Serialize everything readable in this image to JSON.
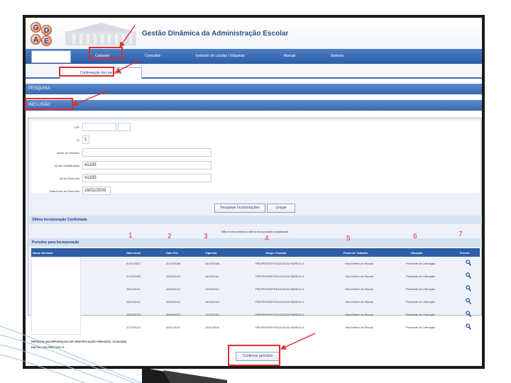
{
  "app": {
    "logo_letters": [
      "G",
      "D",
      "A",
      "E"
    ],
    "title": "Gestão Dinâmica da Administração Escolar"
  },
  "menu": {
    "items": [
      "Cadastro",
      "Consultas",
      "Emissão de Laudas / Etiquetas",
      "Manual",
      "Sistema"
    ]
  },
  "tab": {
    "label": "Confirmação dos períodos"
  },
  "sections": {
    "pesquisa": "PESQUISA",
    "inclusao": "INCLUSÃO"
  },
  "form": {
    "fields": [
      {
        "label": "CPF",
        "value": ""
      },
      {
        "label": "DI",
        "value": "1"
      },
      {
        "label": "Nome do Servidor",
        "value": ""
      },
      {
        "label": "UA de Classificação",
        "value": "41335"
      },
      {
        "label": "UA de Exercício",
        "value": "41335"
      },
      {
        "label": "Data Início de Exercício",
        "value": "16/02/2009"
      }
    ],
    "search_button": "Pesquisar Incorporações",
    "clear_button": "Limpar"
  },
  "ultima": {
    "title": "Última Incorporação Confirmada",
    "notice": "Não foi encontrada a última incorporação cadastrada"
  },
  "periodos": {
    "title": "Períodos para Incorporação",
    "columns": [
      "Nome Servidor",
      "Data Inicio",
      "Data Fim",
      "Vigência",
      "Cargo / Função",
      "Posto de Trabalho",
      "Situação",
      "Evento"
    ],
    "rows": [
      {
        "inicio": "01/11/2007",
        "fim": "31/10/2008",
        "vigencia": "31/10/2008",
        "cargo": "PROFESSOR EDUCACAO BASICA II",
        "posto": "Vice-Diretor de Escola",
        "situacao": "Pendente de Liberação"
      },
      {
        "inicio": "17/02/2009",
        "fim": "15/10/2010",
        "vigencia": "16/10/2011",
        "cargo": "PROFESSOR EDUCACAO BASICA II",
        "posto": "Vice-Diretor de Escola",
        "situacao": "Pendente de Liberação"
      },
      {
        "inicio": "15/12/2011",
        "fim": "16/10/2012",
        "vigencia": "19/10/2012",
        "cargo": "PROFESSOR EDUCACAO BASICA II",
        "posto": "Vice-Diretor de Escola",
        "situacao": "Pendente de Liberação"
      },
      {
        "inicio": "16/12/2012",
        "fim": "15/10/2013",
        "vigencia": "16/10/2013",
        "cargo": "PROFESSOR EDUCACAO BASICA II",
        "posto": "Vice-Diretor de Escola",
        "situacao": "Pendente de Liberação"
      },
      {
        "inicio": "16/12/2013",
        "fim": "16/10/2014",
        "vigencia": "17/10/2014",
        "cargo": "PROFESSOR EDUCACAO BASICA II",
        "posto": "Vice-Diretor de Escola",
        "situacao": "Pendente de Liberação"
      },
      {
        "inicio": "17/12/2014",
        "fim": "02/11/2015",
        "vigencia": "23/11/2015",
        "cargo": "PROFESSOR EDUCACAO BASICA II",
        "posto": "Vice-Diretor de Escola",
        "situacao": "Pendente de Liberação"
      }
    ]
  },
  "footer": {
    "line1": "PRÓXIMA INCORPORAÇÃO DE GRATIFICAÇÃO PREVISTA: 31/10/2016",
    "line2": "FALTAS NO PERÍODO: 0"
  },
  "confirm_button": "Confirmar períodos",
  "annotations": [
    "1",
    "2",
    "3",
    "4",
    "5",
    "6",
    "7"
  ],
  "colors": {
    "accent": "#2f5ea6",
    "annotation": "#e02c2c",
    "header_text": "#2f4f8c"
  }
}
